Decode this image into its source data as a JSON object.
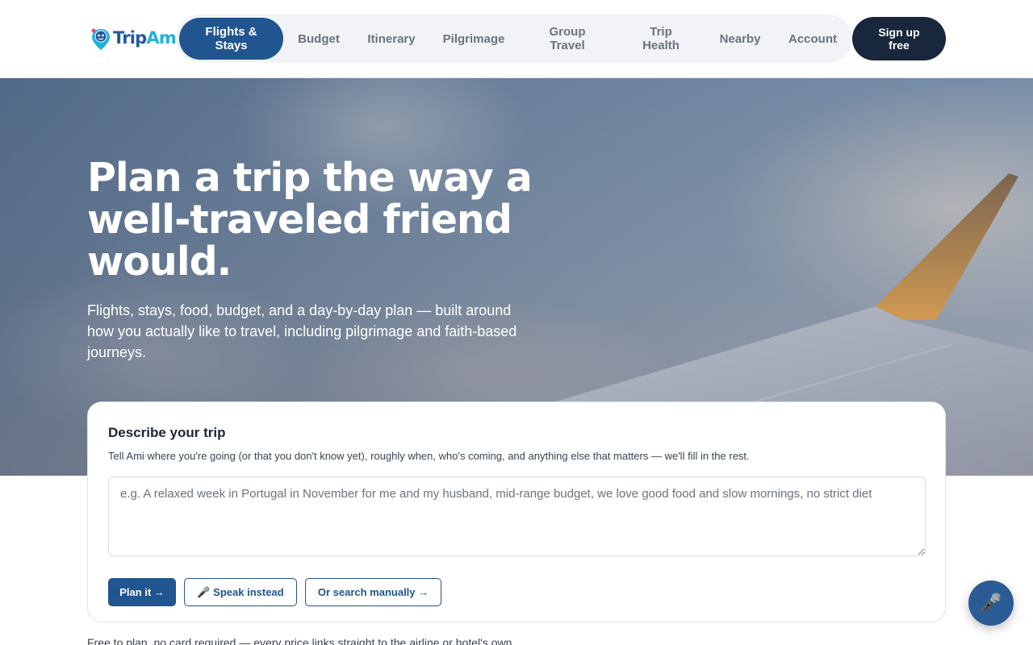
{
  "brand": {
    "name_part1": "Trip",
    "name_part2": "Ami",
    "primary_color": "#21558f",
    "accent_color": "#20b3d8",
    "dark_color": "#18273b"
  },
  "nav": {
    "items": [
      {
        "label": "Flights & Stays",
        "active": true
      },
      {
        "label": "Budget"
      },
      {
        "label": "Itinerary"
      },
      {
        "label": "Pilgrimage"
      },
      {
        "label": "Group Travel"
      },
      {
        "label": "Trip Health"
      },
      {
        "label": "Nearby"
      },
      {
        "label": "Account"
      }
    ],
    "signup_label": "Sign up free"
  },
  "hero": {
    "title": "Plan a trip the way a well-traveled friend would.",
    "subtitle": "Flights, stays, food, budget, and a day-by-day plan — built around how you actually like to travel, including pilgrimage and faith-based journeys."
  },
  "planner": {
    "title": "Describe your trip",
    "description": "Tell Ami where you're going (or that you don't know yet), roughly when, who's coming, and anything else that matters — we'll fill in the rest.",
    "input_value": "",
    "input_placeholder": "e.g. A relaxed week in Portugal in November for me and my husband, mid-range budget, we love good food and slow mornings, no strict diet",
    "plan_button": "Plan it →",
    "speak_button": "🎤 Speak instead",
    "manual_button": "Or search manually →"
  },
  "footnote": "Free to plan, no card required — every price links straight to the airline or hotel's own",
  "mic_fab": {
    "icon": "microphone-icon",
    "glyph": "🎤"
  }
}
